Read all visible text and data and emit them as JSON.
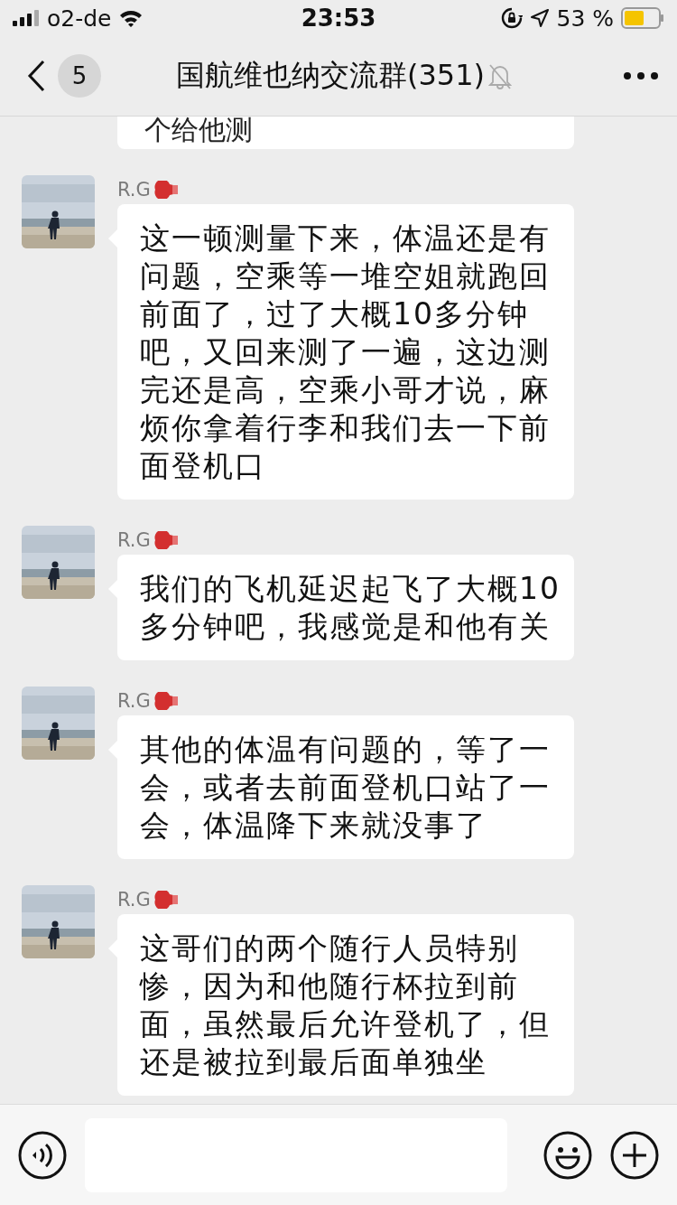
{
  "status_bar": {
    "carrier": "o2-de",
    "time": "23:53",
    "battery_text": "53 %"
  },
  "header": {
    "unread_count": "5",
    "title": "国航维也纳交流群(351)",
    "muted": true
  },
  "messages": [
    {
      "kind": "partial",
      "text": "个给他测"
    },
    {
      "kind": "incoming",
      "sender": "R.G",
      "text": "这一顿测量下来，体温还是有问题，空乘等一堆空姐就跑回前面了，过了大概10多分钟吧，又回来测了一遍，这边测完还是高，空乘小哥才说，麻烦你拿着行李和我们去一下前面登机口"
    },
    {
      "kind": "incoming",
      "sender": "R.G",
      "text": "我们的飞机延迟起飞了大概10多分钟吧，我感觉是和他有关"
    },
    {
      "kind": "incoming",
      "sender": "R.G",
      "text": "其他的体温有问题的，等了一会，或者去前面登机口站了一会，体温降下来就没事了"
    },
    {
      "kind": "incoming",
      "sender": "R.G",
      "text": "这哥们的两个随行人员特别惨，因为和他随行杯拉到前面，虽然最后允许登机了，但还是被拉到最后面单独坐"
    }
  ]
}
